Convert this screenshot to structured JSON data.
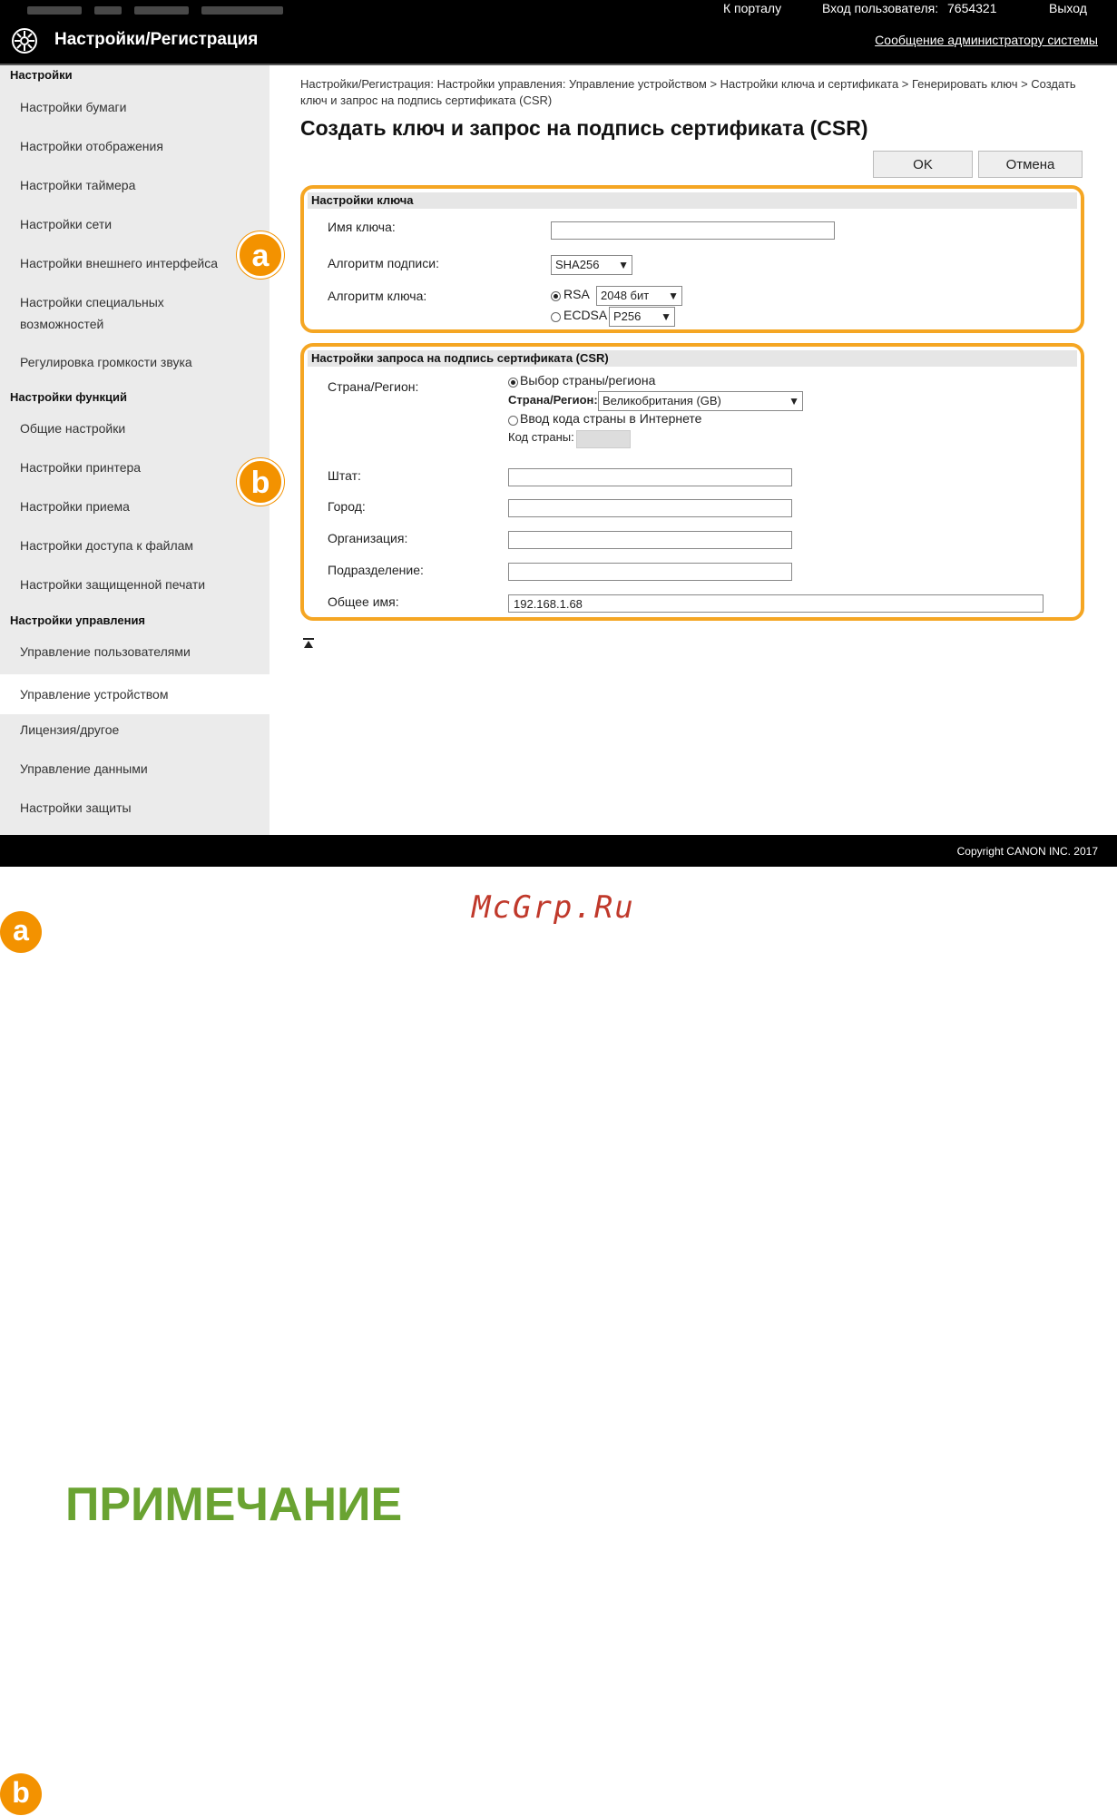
{
  "topbar": {
    "portal_link": "К порталу",
    "login_label": "Вход пользователя:",
    "user_id": "7654321",
    "logout_link": "Выход"
  },
  "header": {
    "app_title": "Настройки/Регистрация",
    "admin_message_link": "Сообщение администратору системы"
  },
  "sidebar": {
    "sections": [
      {
        "heading": "Настройки",
        "items": [
          "Настройки бумаги",
          "Настройки отображения",
          "Настройки таймера",
          "Настройки сети",
          "Настройки внешнего интерфейса",
          "Настройки специальных возможностей",
          "Регулировка громкости звука"
        ]
      },
      {
        "heading": "Настройки функций",
        "items": [
          "Общие настройки",
          "Настройки принтера",
          "Настройки приема",
          "Настройки доступа к файлам",
          "Настройки защищенной печати"
        ]
      },
      {
        "heading": "Настройки управления",
        "items": [
          "Управление пользователями",
          "Управление устройством",
          "Лицензия/другое",
          "Управление данными",
          "Настройки защиты"
        ]
      }
    ],
    "active_item": "Управление устройством"
  },
  "main": {
    "breadcrumb": "Настройки/Регистрация: Настройки управления: Управление устройством > Настройки ключа и сертификата > Генерировать ключ > Создать ключ и запрос на подпись сертификата (CSR)",
    "page_title": "Создать ключ и запрос на подпись сертификата (CSR)",
    "ok_label": "OK",
    "cancel_label": "Отмена",
    "key_settings": {
      "heading": "Настройки ключа",
      "key_name_label": "Имя ключа:",
      "key_name_value": "",
      "sig_algo_label": "Алгоритм подписи:",
      "sig_algo_value": "SHA256",
      "key_algo_label": "Алгоритм ключа:",
      "rsa_label": "RSA",
      "rsa_value": "2048 бит",
      "ecdsa_label": "ECDSA",
      "ecdsa_value": "P256"
    },
    "csr_settings": {
      "heading": "Настройки запроса на подпись сертификата (CSR)",
      "country_label": "Страна/Регион:",
      "select_country_option": "Выбор страны/региона",
      "country_region_label": "Страна/Регион:",
      "country_value": "Великобритания (GB)",
      "internet_code_option": "Ввод кода страны в Интернете",
      "country_code_label": "Код страны:",
      "state_label": "Штат:",
      "city_label": "Город:",
      "org_label": "Организация:",
      "unit_label": "Подразделение:",
      "common_name_label": "Общее имя:",
      "common_name_value": "192.168.1.68"
    },
    "badges": {
      "a": "a",
      "b": "b"
    }
  },
  "footer": {
    "copyright": "Copyright CANON INC. 2017"
  },
  "page": {
    "watermark": "McGrp.Ru",
    "note_heading": "ПРИМЕЧАНИЕ",
    "badge_a": "a",
    "badge_b": "b"
  },
  "colors": {
    "accent_orange": "#f39200",
    "note_green": "#6aa332",
    "watermark_red": "#c0392b"
  }
}
